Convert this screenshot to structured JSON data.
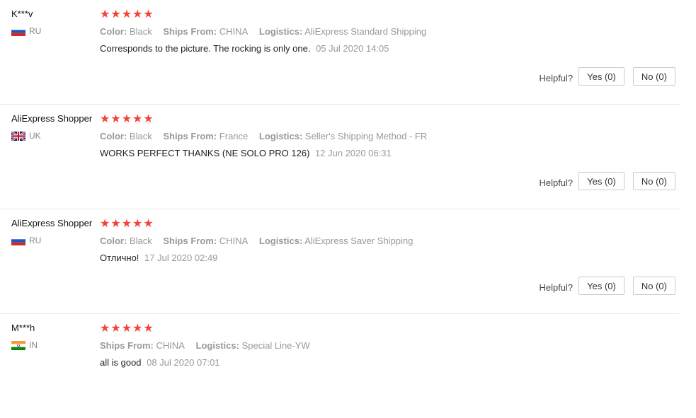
{
  "helpful_label": "Helpful?",
  "star_glyphs": "★★★★★",
  "reviews": [
    {
      "name": "K***v",
      "country": "RU",
      "flag": "ru-flag-icon",
      "rating": 5,
      "color_label": "Color:",
      "color": "Black",
      "ships_label": "Ships From:",
      "ships": "CHINA",
      "logistics_label": "Logistics:",
      "logistics": "AliExpress Standard Shipping",
      "text": "Corresponds to the picture. The rocking is only one.",
      "date": "05 Jul 2020 14:05",
      "yes": "Yes (0)",
      "no": "No (0)"
    },
    {
      "name": "AliExpress Shopper",
      "country": "UK",
      "flag": "uk-flag-icon",
      "rating": 5,
      "color_label": "Color:",
      "color": "Black",
      "ships_label": "Ships From:",
      "ships": "France",
      "logistics_label": "Logistics:",
      "logistics": "Seller's Shipping Method - FR",
      "text": "WORKS PERFECT THANKS (NE SOLO PRO 126)",
      "date": "12 Jun 2020 06:31",
      "yes": "Yes (0)",
      "no": "No (0)"
    },
    {
      "name": "AliExpress Shopper",
      "country": "RU",
      "flag": "ru-flag-icon",
      "rating": 5,
      "color_label": "Color:",
      "color": "Black",
      "ships_label": "Ships From:",
      "ships": "CHINA",
      "logistics_label": "Logistics:",
      "logistics": "AliExpress Saver Shipping",
      "text": "Отлично!",
      "date": "17 Jul 2020 02:49",
      "yes": "Yes (0)",
      "no": "No (0)"
    },
    {
      "name": "M***h",
      "country": "IN",
      "flag": "in-flag-icon",
      "rating": 5,
      "ships_label": "Ships From:",
      "ships": "CHINA",
      "logistics_label": "Logistics:",
      "logistics": "Special Line-YW",
      "text": "all is good",
      "date": "08 Jul 2020 07:01"
    }
  ],
  "colors": {
    "star": "#f44336",
    "muted": "#999999",
    "divider": "#e8e8e8"
  }
}
